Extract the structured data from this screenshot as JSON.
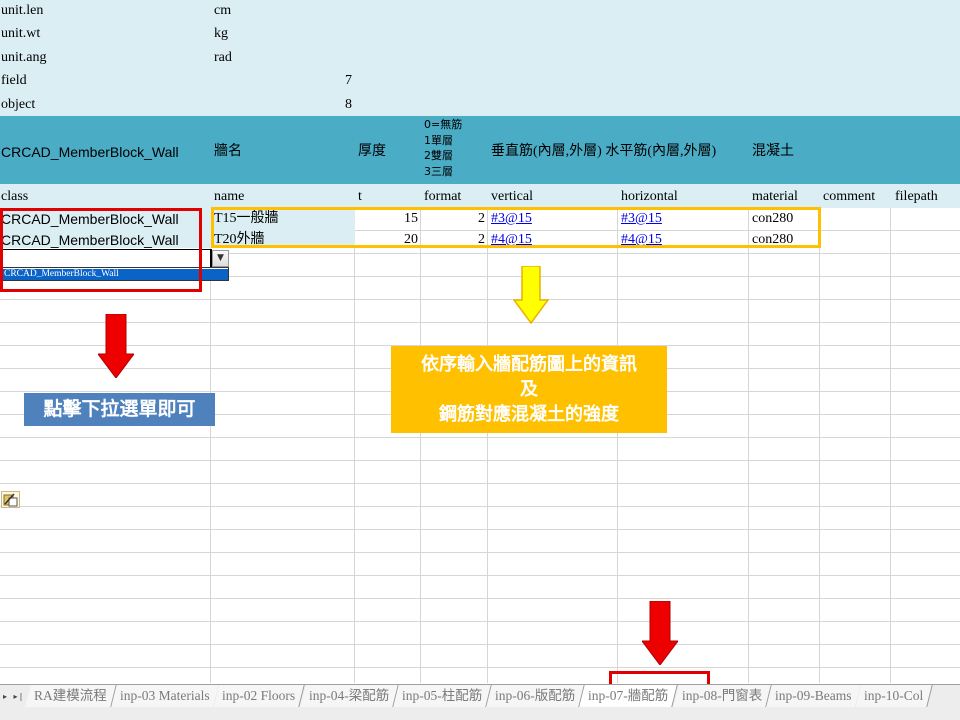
{
  "meta_rows": [
    {
      "key": "unit.len",
      "value": "cm"
    },
    {
      "key": "unit.wt",
      "value": "kg"
    },
    {
      "key": "unit.ang",
      "value": "rad"
    },
    {
      "key": "field",
      "value": "7"
    },
    {
      "key": "object",
      "value": "8"
    }
  ],
  "title_row": {
    "block": "CRCAD_MemberBlock_Wall",
    "name": "牆名",
    "thickness": "厚度",
    "format_legend": [
      "0=無筋",
      "1單層",
      "2雙層",
      "3三層"
    ],
    "vertical_horizontal": "垂直筋(內層,外層) 水平筋(內層,外層)",
    "concrete": "混凝土"
  },
  "columns": [
    "class",
    "name",
    "t",
    "format",
    "vertical",
    "horizontal",
    "material",
    "comment",
    "filepath"
  ],
  "rows": [
    {
      "class": "CRCAD_MemberBlock_Wall",
      "name": "T15一般牆",
      "t": "15",
      "format": "2",
      "vertical": "#3@15",
      "horizontal": "#3@15",
      "material": "con280"
    },
    {
      "class": "CRCAD_MemberBlock_Wall",
      "name": "T20外牆",
      "t": "20",
      "format": "2",
      "vertical": "#4@15",
      "horizontal": "#4@15",
      "material": "con280"
    }
  ],
  "dropdown": {
    "button_glyph": "▼",
    "option": "CRCAD_MemberBlock_Wall"
  },
  "callouts": {
    "dropdown_hint": "點擊下拉選單即可",
    "input_hint_line1": "依序輸入牆配筋圖上的資訊",
    "input_hint_line2": "及",
    "input_hint_line3": "鋼筋對應混凝土的強度"
  },
  "sheet_nav": "▸ ▸|",
  "sheet_tabs": [
    "RA建模流程",
    "inp-03 Materials",
    "inp-02 Floors",
    "inp-04-梁配筋",
    "inp-05-柱配筋",
    "inp-06-版配筋",
    "inp-07-牆配筋",
    "inp-08-門窗表",
    "inp-09-Beams",
    "inp-10-Col"
  ],
  "colors": {
    "header_band": "#4bacc6",
    "light_band": "#daeef3",
    "highlight_red": "#e00000",
    "highlight_gold": "#ffc000",
    "callout_blue": "#4f81bd",
    "link": "#0000ee"
  }
}
